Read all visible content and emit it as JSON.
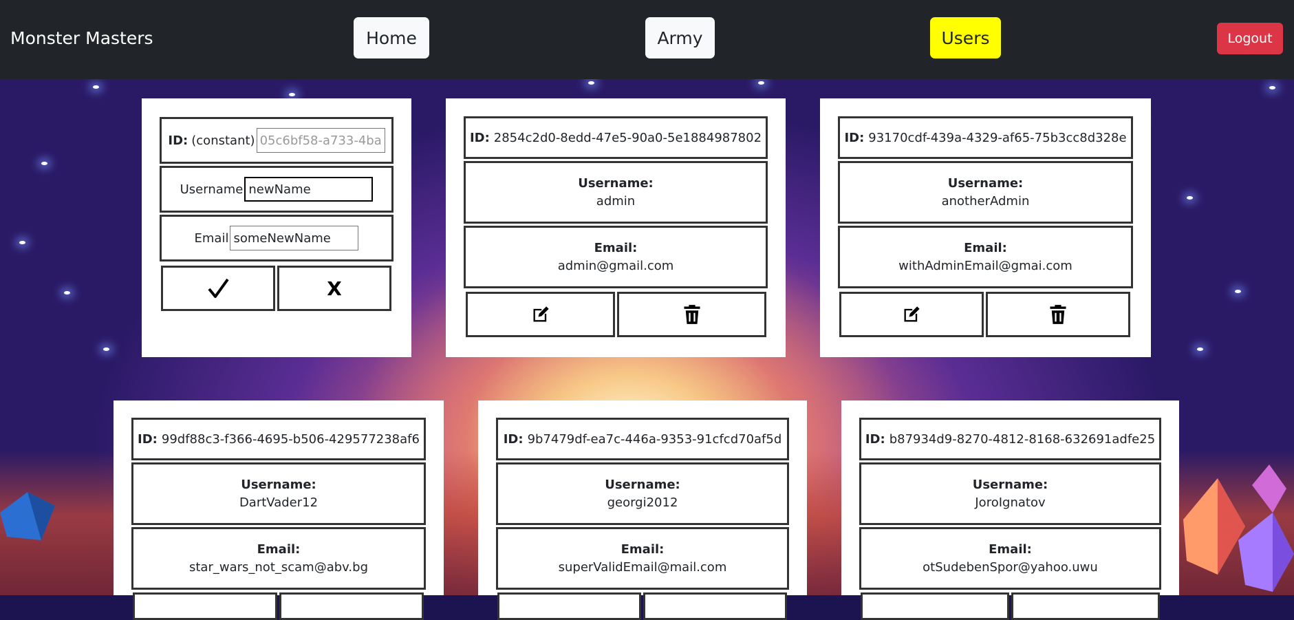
{
  "app": {
    "title": "Monster Masters"
  },
  "nav": {
    "home": "Home",
    "army": "Army",
    "users": "Users",
    "logout": "Logout",
    "active": "Users"
  },
  "colors": {
    "navbar": "#212529",
    "active_tab": "#ffff00",
    "logout": "#dc3545",
    "card_border": "#333333"
  },
  "edit_card": {
    "id_label": "ID:",
    "id_note": "(constant)",
    "id_value": "05c6bf58-a733-4ba",
    "username_label": "Username",
    "username_value": "newName",
    "email_label": "Email",
    "email_value": "someNewName",
    "confirm_icon": "checkmark-icon",
    "cancel_label": "X"
  },
  "users": [
    {
      "id": "2854c2d0-8edd-47e5-90a0-5e1884987802",
      "username": "admin",
      "email": "admin@gmail.com"
    },
    {
      "id": "93170cdf-439a-4329-af65-75b3cc8d328e",
      "username": "anotherAdmin",
      "email": "withAdminEmail@gmai.com"
    },
    {
      "id": "99df88c3-f366-4695-b506-429577238af6",
      "username": "DartVader12",
      "email": "star_wars_not_scam@abv.bg"
    },
    {
      "id": "9b7479df-ea7c-446a-9353-91cfcd70af5d",
      "username": "georgi2012",
      "email": "superValidEmail@mail.com"
    },
    {
      "id": "b87934d9-8270-4812-8168-632691adfe25",
      "username": "JoroIgnatov",
      "email": "otSudebenSpor@yahoo.uwu"
    }
  ],
  "labels": {
    "id": "ID:",
    "username": "Username:",
    "email": "Email:"
  },
  "icons": {
    "edit": "edit-icon",
    "delete": "trash-icon"
  }
}
